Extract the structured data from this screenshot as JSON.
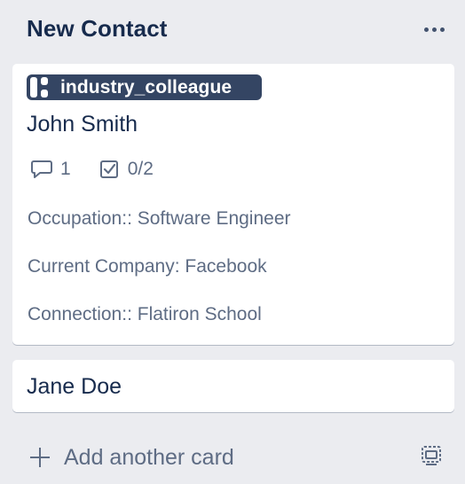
{
  "list": {
    "title": "New Contact",
    "menu_icon": "ellipsis-icon"
  },
  "cards": [
    {
      "label": {
        "text": "industry_colleague",
        "color": "#344563"
      },
      "title": "John Smith",
      "badges": {
        "comments": "1",
        "checklist": "0/2"
      },
      "description": [
        "Occupation:: Software Engineer",
        "Current Company: Facebook",
        "Connection:: Flatiron School"
      ]
    },
    {
      "title": "Jane Doe"
    }
  ],
  "footer": {
    "add_card_label": "Add another card",
    "add_icon": "plus-icon",
    "template_icon": "card-template-icon"
  },
  "colors": {
    "list_bg": "#ebecf0",
    "card_bg": "#ffffff",
    "title_text": "#172b4d",
    "muted_text": "#5e6c84"
  }
}
